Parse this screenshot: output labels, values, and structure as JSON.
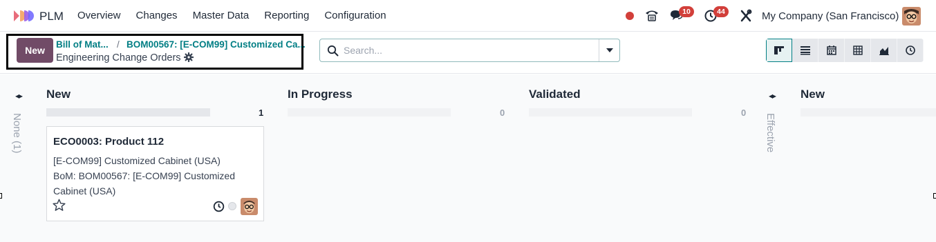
{
  "navbar": {
    "app_name": "PLM",
    "menu": [
      "Overview",
      "Changes",
      "Master Data",
      "Reporting",
      "Configuration"
    ],
    "chat_badge": "10",
    "activity_badge": "44",
    "company": "My Company (San Francisco)"
  },
  "control": {
    "new_label": "New",
    "breadcrumb_1": "Bill of Mat...",
    "breadcrumb_sep": "/",
    "breadcrumb_2": "BOM00567: [E-COM99] Customized Ca...",
    "title": "Engineering Change Orders",
    "search_placeholder": "Search..."
  },
  "views": [
    "kanban-view",
    "list-view",
    "calendar-view",
    "pivot-view",
    "graph-view",
    "activity-view"
  ],
  "kanban": {
    "folded_left_label": "None (1)",
    "folded_right_label": "Effective",
    "columns": [
      {
        "title": "New",
        "count": "1"
      },
      {
        "title": "In Progress",
        "count": "0"
      },
      {
        "title": "Validated",
        "count": "0"
      },
      {
        "title": "New",
        "count": ""
      }
    ],
    "card": {
      "title": "ECO0003: Product 112",
      "line1": "[E-COM99] Customized Cabinet (USA)",
      "line2": "BoM: BOM00567: [E-COM99] Customized Cabinet (USA)"
    }
  },
  "colors": {
    "brand": "#714b67",
    "link": "#017e84",
    "badge": "#d23f3a"
  }
}
